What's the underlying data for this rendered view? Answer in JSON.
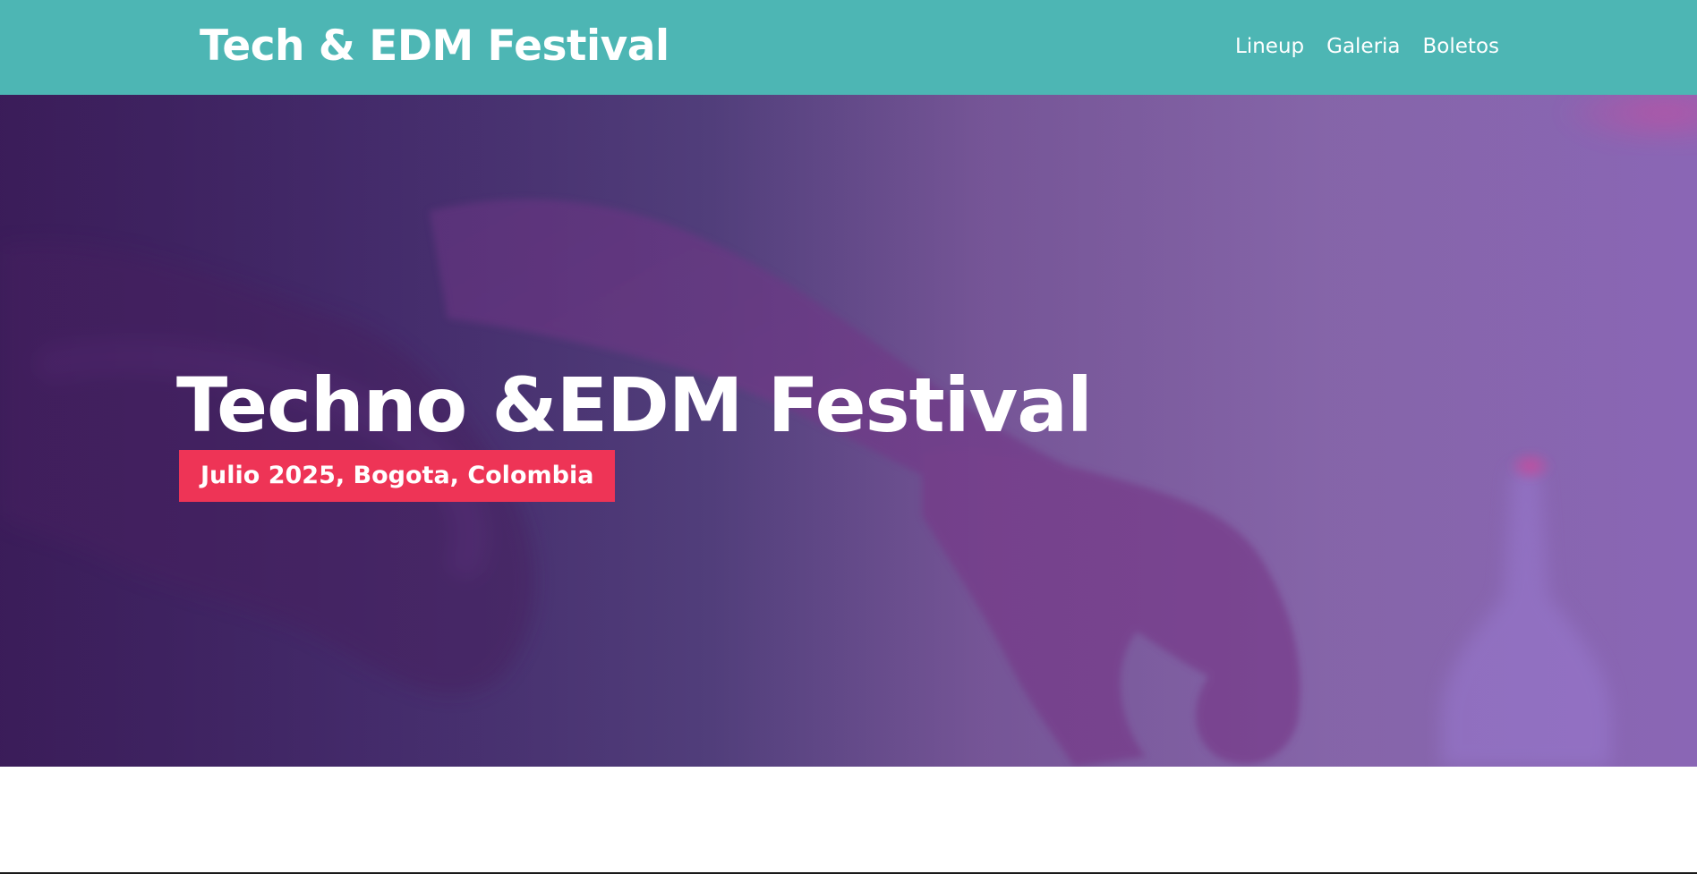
{
  "header": {
    "logo_text": "Tech & EDM Festival",
    "nav": [
      {
        "label": "Lineup"
      },
      {
        "label": "Galeria"
      },
      {
        "label": "Boletos"
      }
    ],
    "background_color": "#4db6b4"
  },
  "hero": {
    "title": "Techno &EDM Festival",
    "subtitle": "Julio 2025, Bogota, Colombia",
    "badge_color": "#ee3456",
    "image_description_icon": "hands-photo-background"
  }
}
